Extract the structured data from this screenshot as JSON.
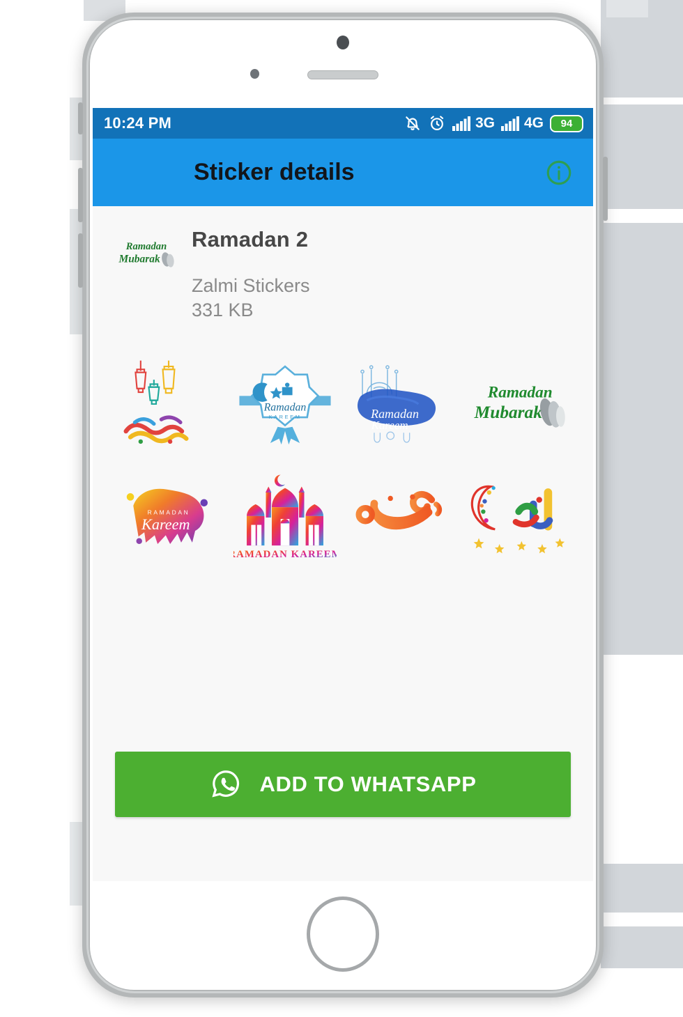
{
  "status_bar": {
    "time": "10:24 PM",
    "icons": [
      "bell-muted-icon",
      "alarm-clock-icon",
      "signal-bars-icon",
      "signal-bars-icon"
    ],
    "network_1": "3G",
    "network_2": "4G",
    "battery_level": "94",
    "bg_color": "#1272b8",
    "battery_color": "#3cb034"
  },
  "app_bar": {
    "title": "Sticker details",
    "info_icon": "info-circle-icon",
    "bg_color": "#1b96e8",
    "title_color": "#12151a",
    "info_icon_color": "#2e9e52"
  },
  "pack": {
    "tray_icon": "ramadan-mubarak-tray-icon",
    "name": "Ramadan 2",
    "publisher": "Zalmi Stickers",
    "size": "331 KB"
  },
  "stickers": [
    {
      "id": "sticker-1",
      "name": "lanterns-ramadan-kareem-arabic",
      "alt": "Colorful hanging lanterns above rainbow Arabic Ramadan Kareem calligraphy"
    },
    {
      "id": "sticker-2",
      "name": "blue-ramadan-kareem-badge",
      "alt": "Blue watercolor badge with crescent moon, mosque and Ramadan Kareem ribbon"
    },
    {
      "id": "sticker-3",
      "name": "blue-watercolor-mosque-ramadan-kareem",
      "alt": "Blue watercolor splash with mosque skyline and Ramadan Kareem script"
    },
    {
      "id": "sticker-4",
      "name": "green-ramadan-mubarak-praying-hands",
      "alt": "Green Ramadan Mubarak lettering with praying hands"
    },
    {
      "id": "sticker-5",
      "name": "rainbow-splash-ramadan-kareem",
      "alt": "Yellow purple watercolor splash with Ramadan Kareem lettering"
    },
    {
      "id": "sticker-6",
      "name": "gradient-mosque-ramadan-kareem",
      "alt": "Pink orange gradient mosque silhouette with RAMADAN KAREEM text"
    },
    {
      "id": "sticker-7",
      "name": "orange-arabic-ramadan-calligraphy",
      "alt": "Orange Arabic Ramadan calligraphy"
    },
    {
      "id": "sticker-8",
      "name": "colorful-crescent-stars-ramadan",
      "alt": "Colorful crescent with stars and multicolor Arabic Ramadan lettering"
    }
  ],
  "action": {
    "label": "ADD TO WHATSAPP",
    "icon": "whatsapp-icon",
    "bg_color": "#4caf31"
  },
  "device": {
    "camera": "front-camera",
    "speaker": "earpiece-speaker",
    "home_button": "home-button"
  }
}
